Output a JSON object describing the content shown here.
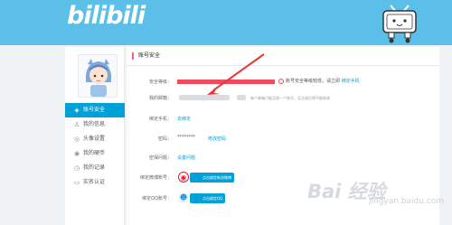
{
  "header": {
    "logo_text": "bilibili",
    "bg_color": "#5bbfe8"
  },
  "sidebar": {
    "items": [
      {
        "label": "账号安全",
        "icon": "shield-icon",
        "active": true
      },
      {
        "label": "我的信息",
        "icon": "user-icon",
        "active": false
      },
      {
        "label": "头像设置",
        "icon": "camera-icon",
        "active": false
      },
      {
        "label": "我的硬币",
        "icon": "coin-icon",
        "active": false
      },
      {
        "label": "我的记录",
        "icon": "clock-icon",
        "active": false
      },
      {
        "label": "实名认证",
        "icon": "id-card-icon",
        "active": false
      }
    ],
    "active_color": "#00a1d6"
  },
  "main": {
    "title": "账号安全",
    "rows": {
      "account": {
        "label": "安全等级："
      },
      "email": {
        "label": "我的邮箱："
      },
      "phone": {
        "label": "绑定手机：",
        "action": "去绑定"
      },
      "password": {
        "label": "密码：",
        "value": "********",
        "action": "修改密码"
      },
      "question": {
        "label": "密保问题：",
        "action": "设置问题"
      },
      "weibo": {
        "label": "绑定微博账号：",
        "button": "点击绑定新浪微博"
      },
      "qq": {
        "label": "绑定QQ账号：",
        "button": "点击绑定QQ"
      }
    },
    "warning": {
      "text": "账号安全等级较低，请立即",
      "action": "绑定手机"
    },
    "email_hint": "每个邮箱只能注册一个账号，且注册后将不能修改",
    "accent_color": "#f25d8e",
    "link_color": "#00a1d6"
  },
  "watermark": {
    "text": "Bai 经验",
    "sub": "jingyan.baidu.com"
  }
}
